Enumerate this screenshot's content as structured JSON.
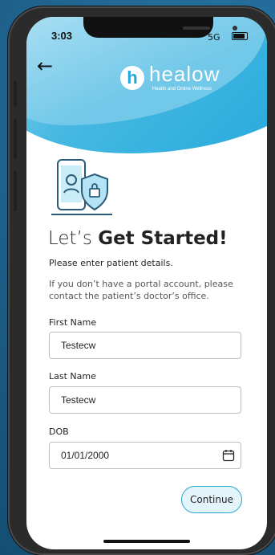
{
  "status": {
    "time": "3:03",
    "network": "5G"
  },
  "brand": {
    "name": "healow",
    "tagline": "Health and Online Wellness",
    "accent": "#22a7db"
  },
  "header": {
    "back_icon": "arrow-left-icon"
  },
  "title": {
    "prefix": "Let’s ",
    "emphasis": "Get Started!"
  },
  "intro": {
    "line1": "Please enter patient details.",
    "line2": "If you don’t have a portal account, please contact the patient’s doctor’s office."
  },
  "form": {
    "first_name": {
      "label": "First Name",
      "value": "Testecw"
    },
    "last_name": {
      "label": "Last Name",
      "value": "Testecw"
    },
    "dob": {
      "label": "DOB",
      "value": "01/01/2000"
    }
  },
  "actions": {
    "continue_label": "Continue"
  }
}
